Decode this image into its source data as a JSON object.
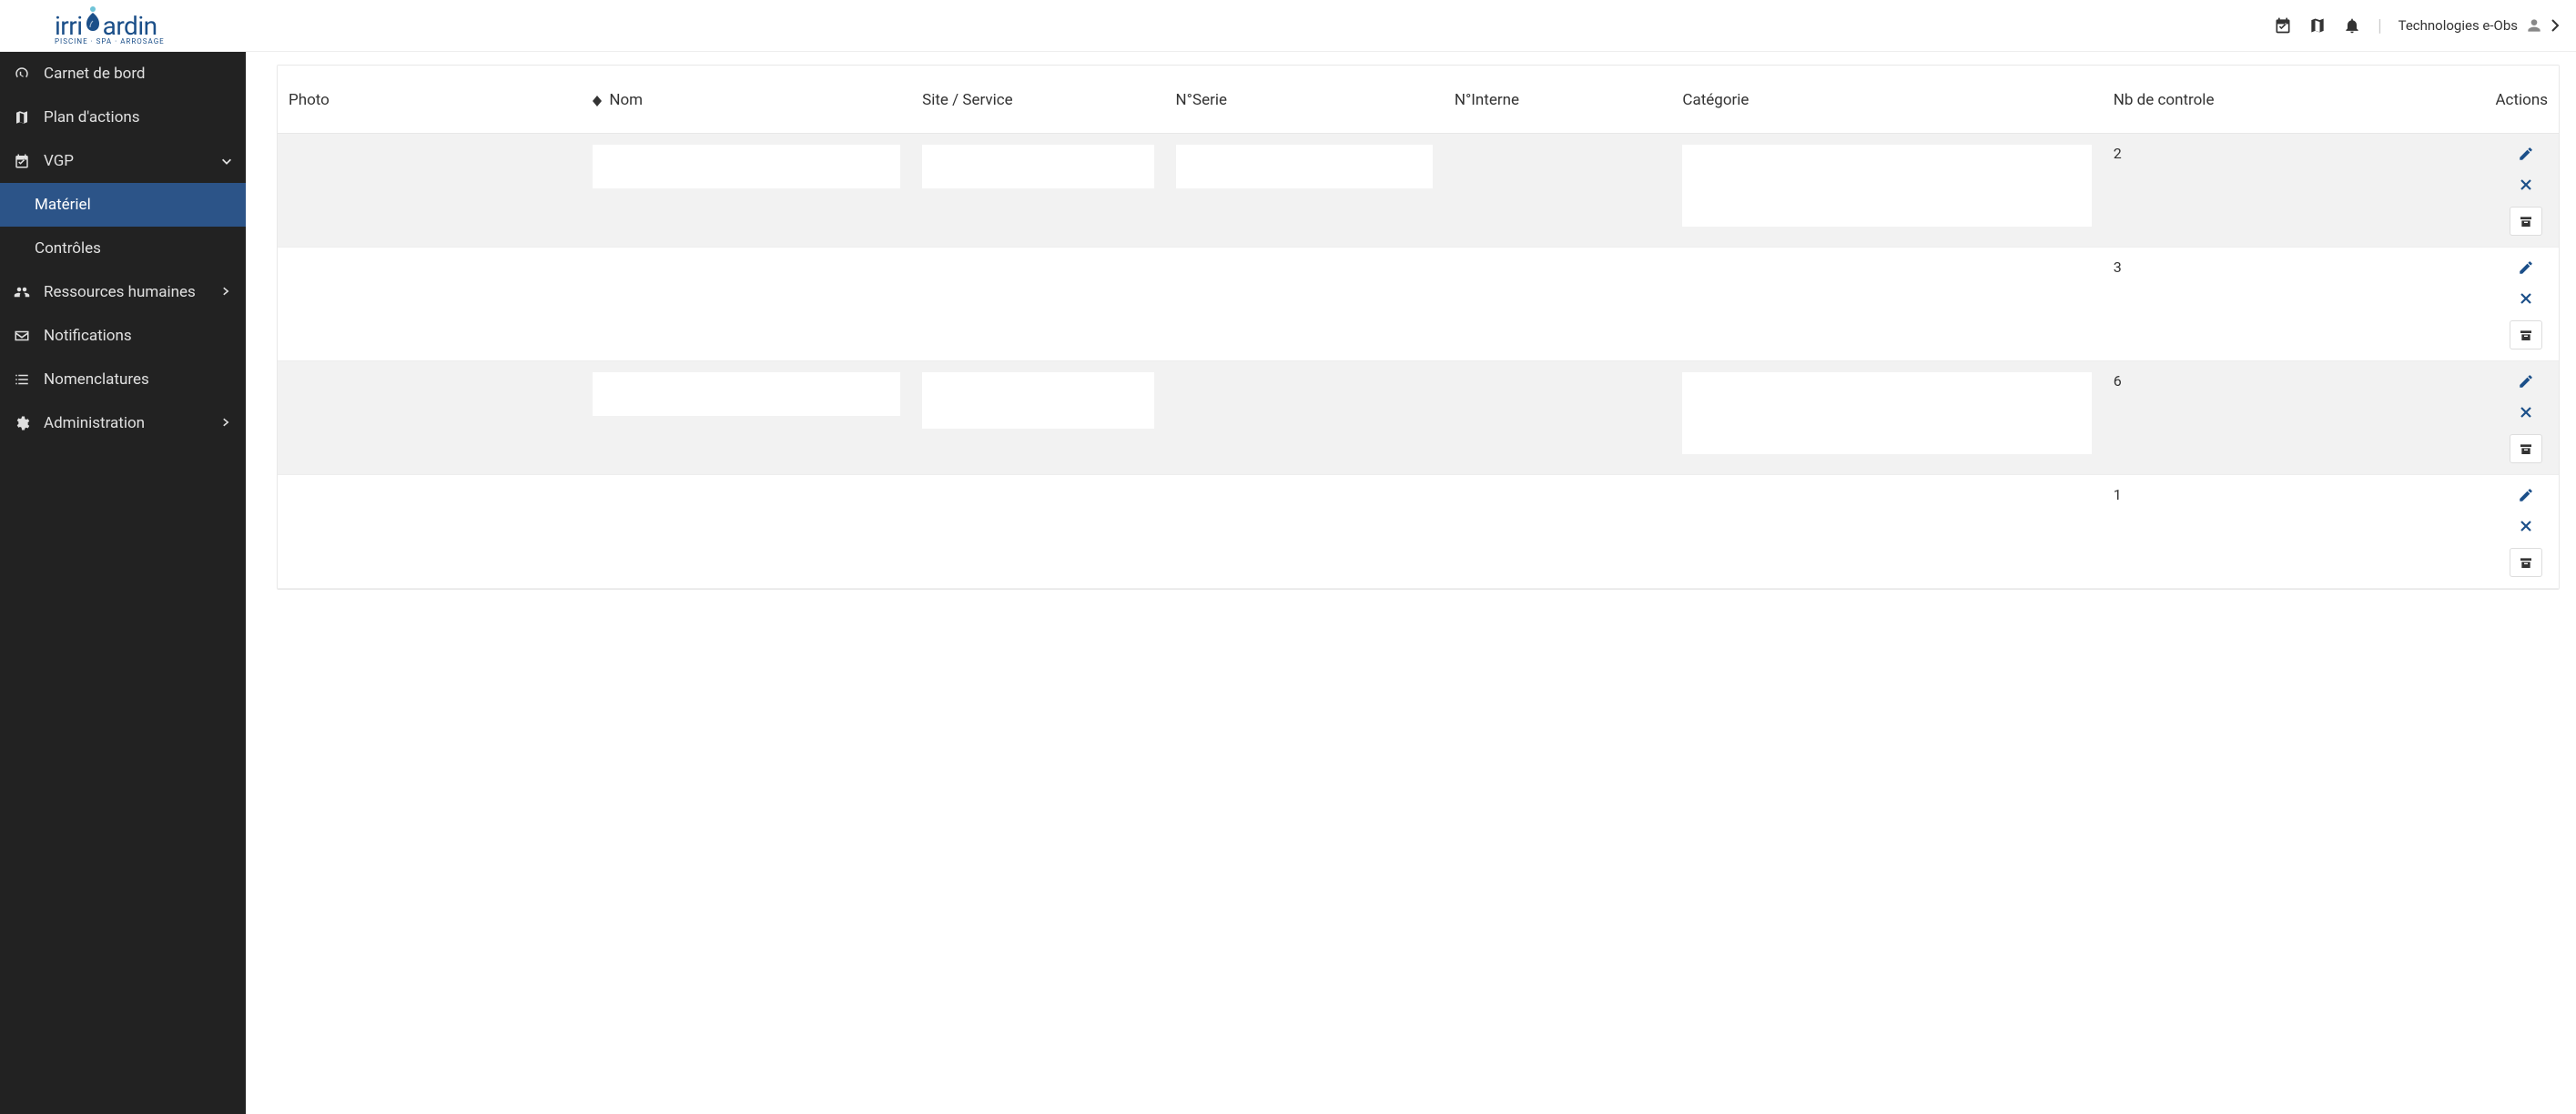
{
  "header": {
    "user_label": "Technologies e-Obs"
  },
  "sidebar": {
    "items": [
      {
        "label": "Carnet de bord",
        "icon": "dashboard-icon"
      },
      {
        "label": "Plan d'actions",
        "icon": "map-icon"
      },
      {
        "label": "VGP",
        "icon": "calendar-check-icon",
        "expanded": true,
        "children": [
          {
            "label": "Matériel",
            "active": true
          },
          {
            "label": "Contrôles"
          }
        ]
      },
      {
        "label": "Ressources humaines",
        "icon": "users-icon",
        "expandable": true
      },
      {
        "label": "Notifications",
        "icon": "envelope-icon"
      },
      {
        "label": "Nomenclatures",
        "icon": "list-icon"
      },
      {
        "label": "Administration",
        "icon": "gear-icon",
        "expandable": true
      }
    ]
  },
  "table": {
    "headers": {
      "photo": "Photo",
      "nom": "Nom",
      "site": "Site / Service",
      "serie": "N°Serie",
      "interne": "N°Interne",
      "categorie": "Catégorie",
      "nb": "Nb de controle",
      "actions": "Actions"
    },
    "rows": [
      {
        "nb": "2"
      },
      {
        "nb": "3"
      },
      {
        "nb": "6"
      },
      {
        "nb": "1"
      }
    ]
  }
}
